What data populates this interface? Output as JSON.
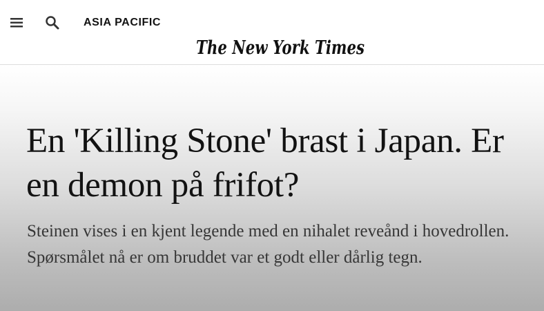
{
  "header": {
    "menu_icon": "hamburger-menu-icon",
    "search_icon": "search-icon",
    "section_label": "ASIA PACIFIC",
    "masthead": "The New York Times"
  },
  "article": {
    "headline": "En 'Killing Stone' brast i Japan. Er en demon på frifot?",
    "summary": "Steinen vises i en kjent legende med en nihalet reveånd i hovedrollen. Spørsmålet nå er om bruddet var et godt eller dårlig tegn."
  },
  "colors": {
    "text": "#121212",
    "summary_text": "#363636",
    "background": "#ffffff",
    "divider": "#dcdcdc"
  }
}
